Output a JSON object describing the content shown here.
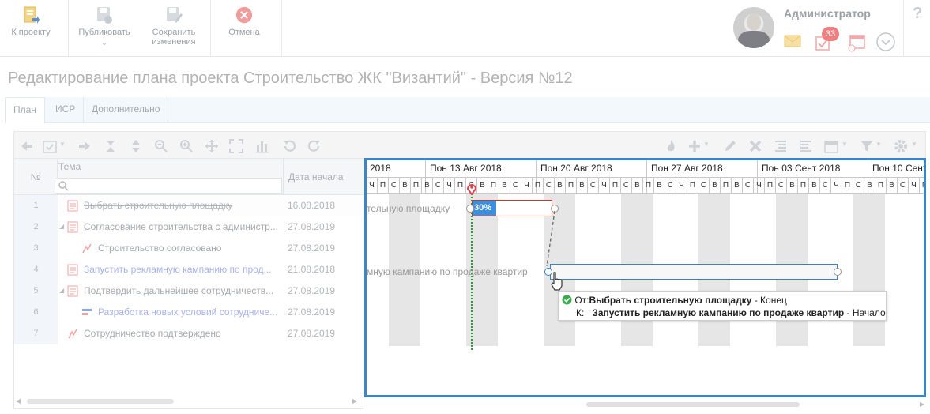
{
  "toolbar": {
    "to_project": "К проекту",
    "publish": "Публиковать",
    "save_line1": "Сохранить",
    "save_line2": "изменения",
    "cancel": "Отмена"
  },
  "user": {
    "name": "Администратор",
    "badge_count": "33"
  },
  "help": "?",
  "page_title": "Редактирование плана проекта Строительство ЖК \"Византий\" - Версия №12",
  "tabs": [
    {
      "label": "План"
    },
    {
      "label": "ИСР"
    },
    {
      "label": "Дополнительно"
    }
  ],
  "grid": {
    "col_num": "№",
    "col_tema": "Тема",
    "col_date": "Дата начала",
    "rows": [
      {
        "num": "1",
        "name": "Выбрать строительную площадку",
        "date": "16.08.2018"
      },
      {
        "num": "2",
        "name": "Согласование строительства с администр...",
        "date": "27.08.2019"
      },
      {
        "num": "3",
        "name": "Строительство согласовано",
        "date": "27.08.2019"
      },
      {
        "num": "4",
        "name": "Запустить рекламную кампанию по прод...",
        "date": "21.08.2018"
      },
      {
        "num": "5",
        "name": "Подтвердить дальнейшее сотрудничеств...",
        "date": "27.08.2019"
      },
      {
        "num": "6",
        "name": "Разработка новых условий сотрудниче...",
        "date": "27.08.2019"
      },
      {
        "num": "7",
        "name": "Сотрудничество подтверждено",
        "date": "27.08.2019"
      }
    ]
  },
  "gantt": {
    "weeks": [
      {
        "label": "2018"
      },
      {
        "label": "Пон 13 Авг 2018"
      },
      {
        "label": "Пон 20 Авг 2018"
      },
      {
        "label": "Пон 27 Авг 2018"
      },
      {
        "label": "Пон 03 Сент 2018"
      },
      {
        "label": "Пон 10 Сент"
      }
    ],
    "day_letters": [
      "П",
      "В",
      "С",
      "Ч",
      "П",
      "С",
      "В"
    ],
    "task1_label": "тельную площадку",
    "task1_progress": "30%",
    "task1_progress_value": 30,
    "task2_label": "мную кампанию по продаже квартир",
    "tooltip": {
      "from_prefix": "От:",
      "from_task": "Выбрать строительную площадку",
      "from_suffix": " - Конец",
      "to_prefix": "К:",
      "to_task": "Запустить рекламную кампанию по продаже квартир",
      "to_suffix": " - Начало"
    }
  },
  "colors": {
    "accent": "#3a87c8",
    "progress": "#3a8fde",
    "critical": "#c0392b",
    "today_line": "#2a9d3a",
    "badge": "#f07f7f"
  }
}
